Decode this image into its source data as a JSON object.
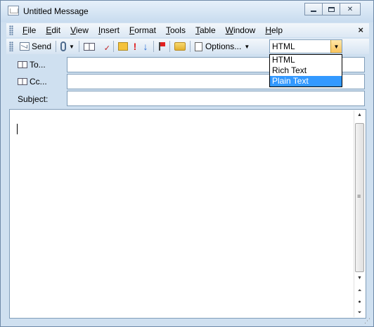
{
  "window": {
    "title": "Untitled Message"
  },
  "menu": {
    "items": [
      {
        "label": "File",
        "key": "F",
        "rest": "ile"
      },
      {
        "label": "Edit",
        "key": "E",
        "rest": "dit"
      },
      {
        "label": "View",
        "key": "V",
        "rest": "iew"
      },
      {
        "label": "Insert",
        "key": "I",
        "rest": "nsert"
      },
      {
        "label": "Format",
        "key": "F",
        "rest": "ormat"
      },
      {
        "label": "Tools",
        "key": "T",
        "rest": "ools"
      },
      {
        "label": "Table",
        "key": "T",
        "rest": "able"
      },
      {
        "label": "Window",
        "key": "W",
        "rest": "indow"
      },
      {
        "label": "Help",
        "key": "H",
        "rest": "elp"
      }
    ],
    "close_glyph": "×"
  },
  "toolbar": {
    "send_label": "Send",
    "options_label": "Options...",
    "format_selected": "HTML"
  },
  "format_dropdown": {
    "options": [
      "HTML",
      "Rich Text",
      "Plain Text"
    ],
    "highlighted": "Plain Text"
  },
  "fields": {
    "to_label": "To...",
    "cc_label": "Cc...",
    "subject_label": "Subject:",
    "to_value": "",
    "cc_value": "",
    "subject_value": ""
  },
  "colors": {
    "selection": "#3399ff",
    "chrome": "#cfe0f0"
  }
}
